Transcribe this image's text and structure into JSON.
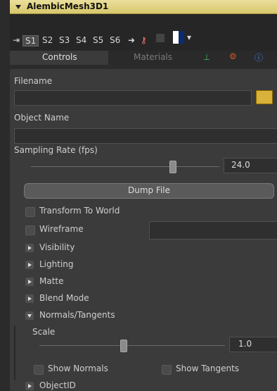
{
  "node": {
    "title": "AlembicMesh3D1"
  },
  "toolbar": {
    "slots": [
      "S1",
      "S2",
      "S3",
      "S4",
      "S5",
      "S6"
    ],
    "tabs": [
      "Controls",
      "Materials"
    ]
  },
  "filename": {
    "label": "Filename",
    "value": ""
  },
  "object_name": {
    "label": "Object Name",
    "value": ""
  },
  "sampling_rate": {
    "label": "Sampling Rate (fps)",
    "value": "24.0",
    "slider": 0.75
  },
  "dump_file": {
    "label": "Dump File"
  },
  "checkboxes": {
    "transform": "Transform To World",
    "wireframe": "Wireframe"
  },
  "sections": {
    "visibility": "Visibility",
    "lighting": "Lighting",
    "matte": "Matte",
    "blend_mode": "Blend Mode",
    "normals_tangents": "Normals/Tangents",
    "objectid": "ObjectID"
  },
  "scale": {
    "label": "Scale",
    "value": "1.0",
    "slider": 0.45
  },
  "show": {
    "normals": "Show Normals",
    "tangents": "Show Tangents"
  }
}
